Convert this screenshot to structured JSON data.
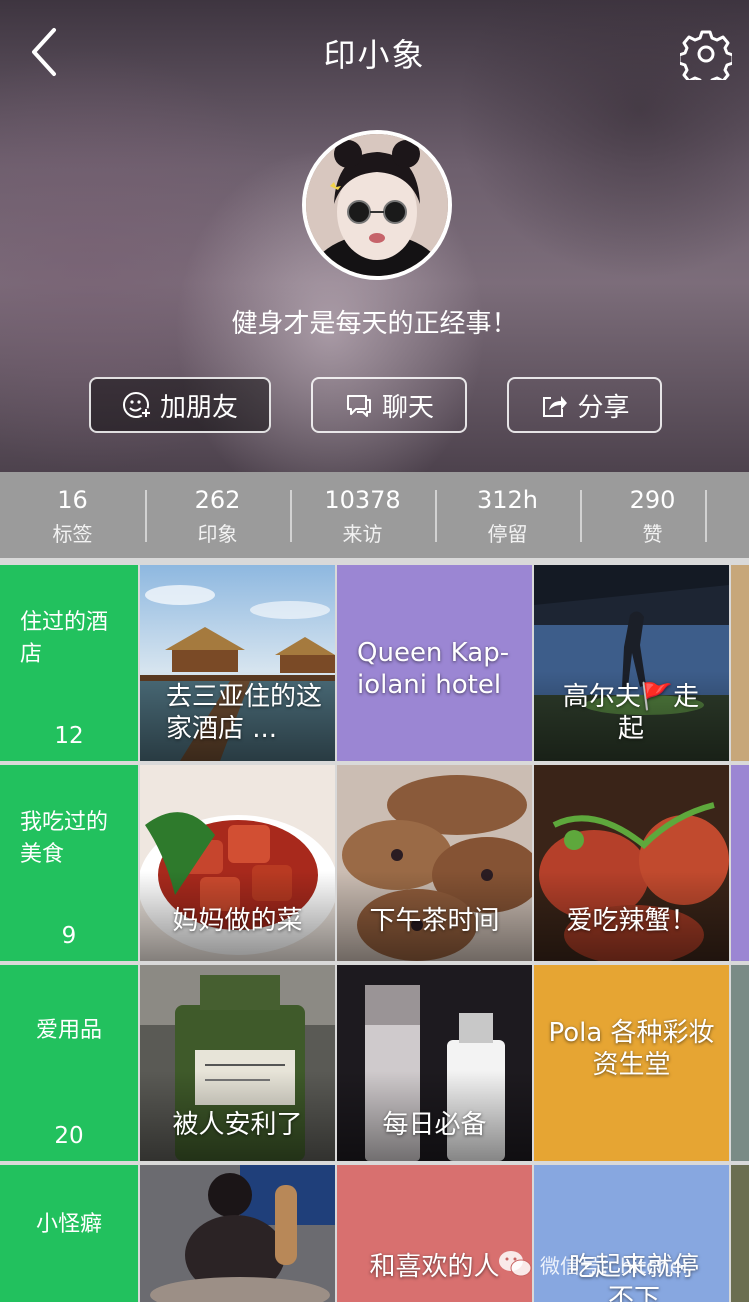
{
  "header": {
    "title": "印小象",
    "motto": "健身才是每天的正经事！",
    "actions": {
      "add_friend": "加朋友",
      "chat": "聊天",
      "share": "分享"
    }
  },
  "stats": [
    {
      "value": "16",
      "label": "标签"
    },
    {
      "value": "262",
      "label": "印象"
    },
    {
      "value": "10378",
      "label": "来访"
    },
    {
      "value": "312h",
      "label": "停留"
    },
    {
      "value": "290",
      "label": "赞"
    }
  ],
  "rows": [
    {
      "category": {
        "name": "住过的酒店",
        "count": "12"
      },
      "tiles": [
        {
          "caption": "去三亚住的这家酒店 ...",
          "type": "photo"
        },
        {
          "caption": "Queen Kap-iolani hotel",
          "type": "color",
          "color": "#9b86d3"
        },
        {
          "caption": "高尔夫🚩走起",
          "type": "photo"
        }
      ]
    },
    {
      "category": {
        "name": "我吃过的美食",
        "count": "9"
      },
      "tiles": [
        {
          "caption": "妈妈做的菜",
          "type": "photo"
        },
        {
          "caption": "下午茶时间",
          "type": "photo"
        },
        {
          "caption": "爱吃辣蟹！",
          "type": "photo"
        }
      ]
    },
    {
      "category": {
        "name": "爱用品",
        "count": "20"
      },
      "tiles": [
        {
          "caption": "被人安利了",
          "type": "photo"
        },
        {
          "caption": "每日必备",
          "type": "photo"
        },
        {
          "caption": "Pola 各种彩妆 资生堂",
          "type": "color",
          "color": "#e6a533"
        }
      ]
    },
    {
      "category": {
        "name": "小怪癖",
        "count": ""
      },
      "tiles": [
        {
          "caption": "",
          "type": "photo"
        },
        {
          "caption": "和喜欢的人",
          "type": "color",
          "color": "#d8706f"
        },
        {
          "caption": "吃起来就停不下",
          "type": "color",
          "color": "#87a7e0"
        }
      ]
    }
  ],
  "watermark": "微信号：hitcher",
  "icons": {
    "back": "chevron-left-icon",
    "settings": "gear-icon",
    "add_friend": "smiley-plus-icon",
    "chat": "chat-bubble-icon",
    "share": "share-icon",
    "wechat": "wechat-icon"
  },
  "colors": {
    "category_green": "#22c15e",
    "stats_bar": "#969696"
  }
}
